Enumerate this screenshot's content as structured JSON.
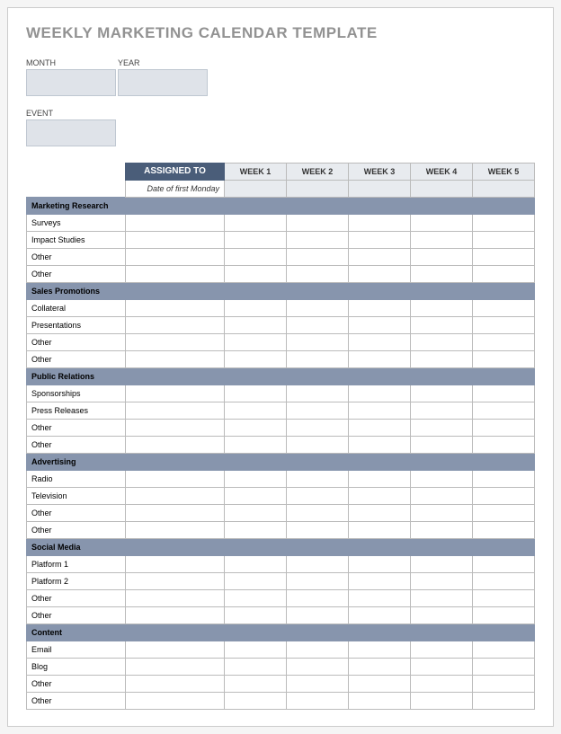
{
  "title": "WEEKLY MARKETING CALENDAR TEMPLATE",
  "meta": {
    "month_label": "MONTH",
    "month_value": "",
    "year_label": "YEAR",
    "year_value": "",
    "event_label": "EVENT",
    "event_value": ""
  },
  "headers": {
    "assigned_to": "ASSIGNED TO",
    "date_first_monday": "Date of first Monday",
    "weeks": [
      "WEEK 1",
      "WEEK 2",
      "WEEK 3",
      "WEEK 4",
      "WEEK 5"
    ]
  },
  "sections": [
    {
      "name": "Marketing Research",
      "items": [
        "Surveys",
        "Impact Studies",
        "Other",
        "Other"
      ]
    },
    {
      "name": "Sales Promotions",
      "items": [
        "Collateral",
        "Presentations",
        "Other",
        "Other"
      ]
    },
    {
      "name": "Public Relations",
      "items": [
        "Sponsorships",
        "Press Releases",
        "Other",
        "Other"
      ]
    },
    {
      "name": "Advertising",
      "items": [
        "Radio",
        "Television",
        "Other",
        "Other"
      ]
    },
    {
      "name": "Social Media",
      "items": [
        "Platform 1",
        "Platform 2",
        "Other",
        "Other"
      ]
    },
    {
      "name": "Content",
      "items": [
        "Email",
        "Blog",
        "Other",
        "Other"
      ]
    }
  ]
}
